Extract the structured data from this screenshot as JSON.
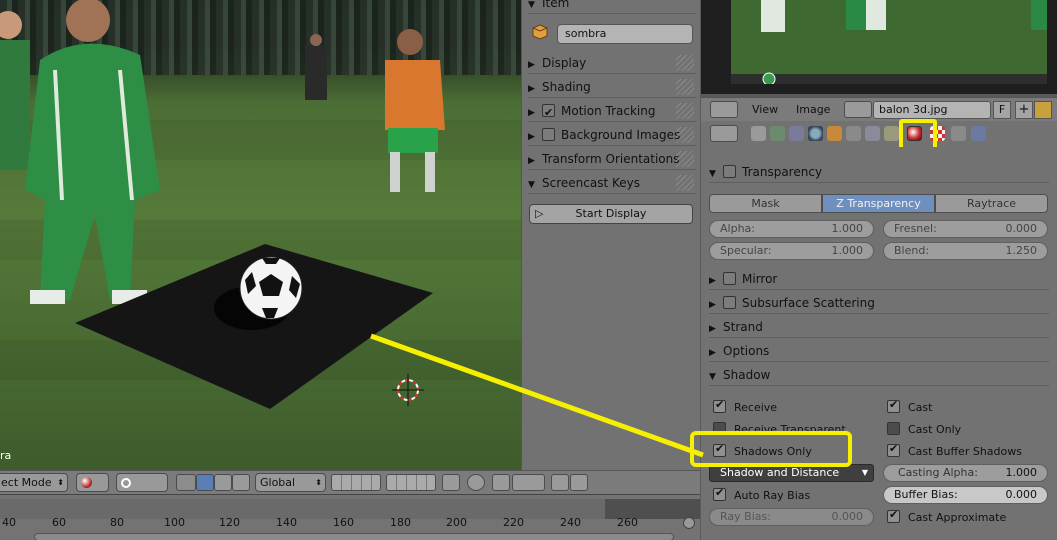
{
  "viewport": {
    "corner_text": "ra",
    "mode_label": "ect Mode",
    "orientation": "Global"
  },
  "timeline": {
    "ticks": [
      "40",
      "60",
      "80",
      "100",
      "120",
      "140",
      "160",
      "180",
      "200",
      "220",
      "240",
      "260"
    ]
  },
  "npanel": {
    "item_header": "Item",
    "object_name": "sombra",
    "rows": [
      {
        "label": "Display",
        "checkbox": false
      },
      {
        "label": "Shading",
        "checkbox": false
      },
      {
        "label": "Motion Tracking",
        "checkbox": true,
        "checked": true
      },
      {
        "label": "Background Images",
        "checkbox": true,
        "checked": false
      },
      {
        "label": "Transform Orientations",
        "checkbox": false
      },
      {
        "label": "Screencast Keys",
        "checkbox": false,
        "expanded": true
      }
    ],
    "start_display": "Start Display"
  },
  "image_editor": {
    "view_menu": "View",
    "image_menu": "Image",
    "image_name": "balon 3d.jpg",
    "fake_user": "F"
  },
  "properties": {
    "transparency": {
      "label": "Transparency",
      "modes": [
        "Mask",
        "Z Transparency",
        "Raytrace"
      ],
      "active_mode": "Z Transparency",
      "alpha_label": "Alpha:",
      "alpha": "1.000",
      "fresnel_label": "Fresnel:",
      "fresnel": "0.000",
      "specular_label": "Specular:",
      "specular": "1.000",
      "blend_label": "Blend:",
      "blend": "1.250"
    },
    "panels": [
      "Mirror",
      "Subsurface Scattering",
      "Strand",
      "Options"
    ],
    "shadow": {
      "label": "Shadow",
      "receive": "Receive",
      "receive_transparent": "Receive Transparent",
      "shadows_only": "Shadows Only",
      "shadow_mode": "Shadow and Distance",
      "auto_ray_bias": "Auto Ray Bias",
      "ray_bias_label": "Ray Bias:",
      "ray_bias": "0.000",
      "cast": "Cast",
      "cast_only": "Cast Only",
      "cast_buffer": "Cast Buffer Shadows",
      "casting_alpha_label": "Casting Alpha:",
      "casting_alpha": "1.000",
      "buffer_bias_label": "Buffer Bias:",
      "buffer_bias": "0.000",
      "cast_approx": "Cast Approximate"
    }
  },
  "colors": {
    "highlight": "#f6f000",
    "selected_mode": "#6f8fbf"
  }
}
